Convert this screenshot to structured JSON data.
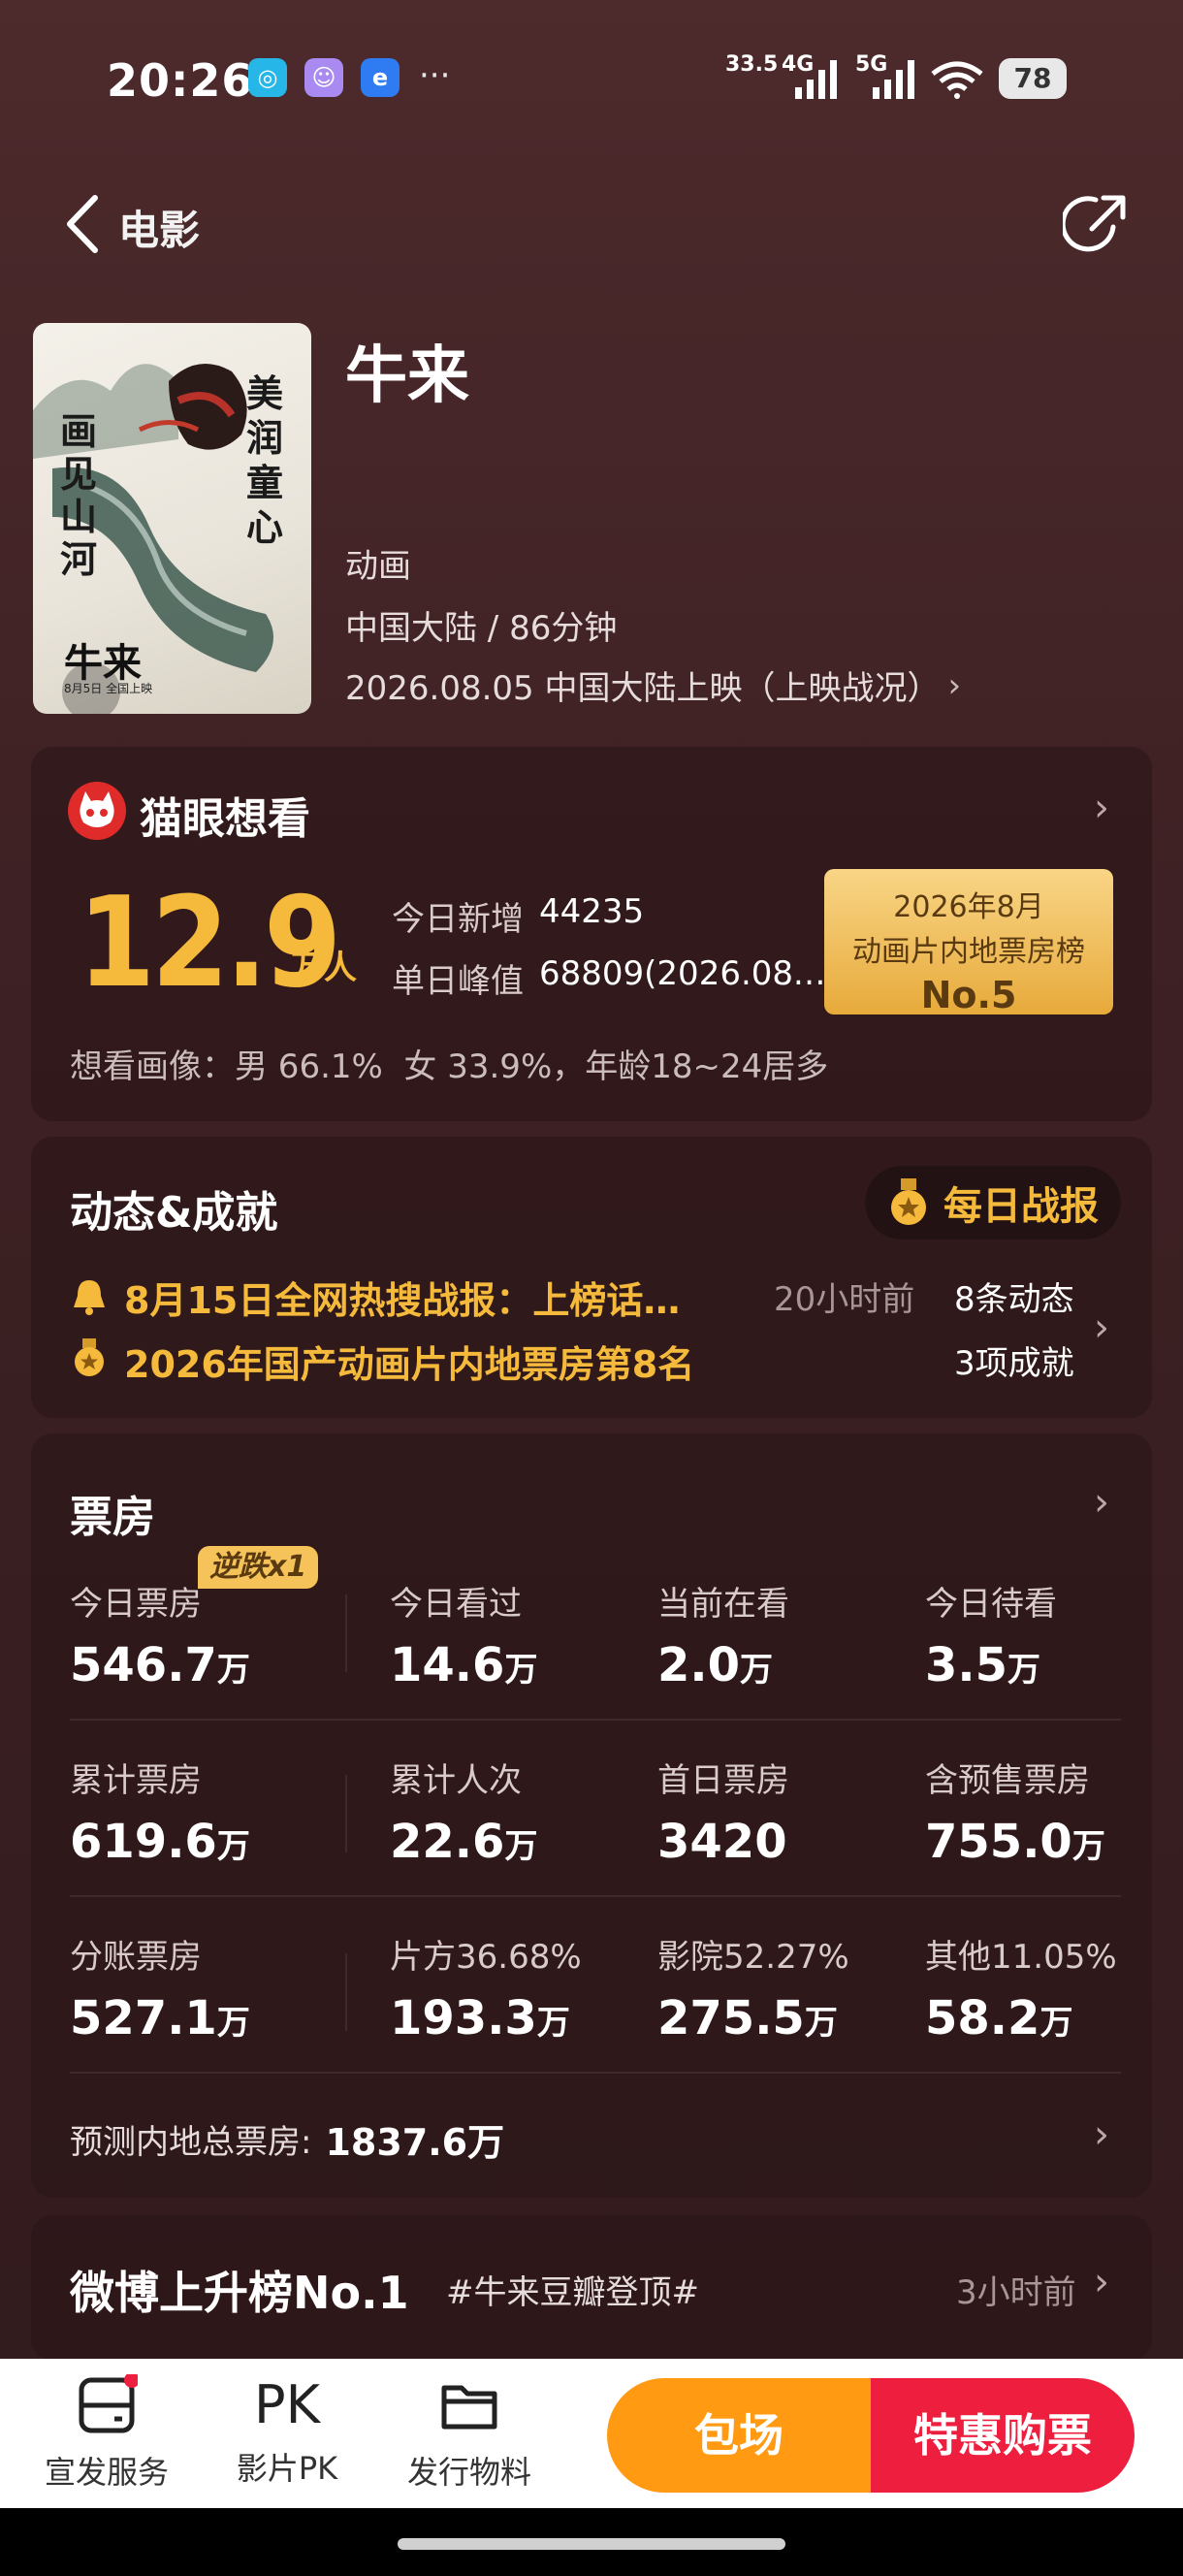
{
  "status_bar": {
    "time": "20:26",
    "net_speed": "33.5",
    "net1": "4G",
    "net2": "5G",
    "battery": "78",
    "more": "···"
  },
  "nav": {
    "back_label": "电影"
  },
  "movie": {
    "title": "牛来",
    "poster_text": {
      "left": "画见山河",
      "right": "美润童心",
      "name": "牛来",
      "date": "8月5日 全国上映"
    },
    "genre": "动画",
    "region_duration": "中国大陆 / 86分钟",
    "release": "2026.08.05 中国大陆上映（上映战况）"
  },
  "wish": {
    "title": "猫眼想看",
    "number": "12.9",
    "unit": "万人",
    "today_label": "今日新增",
    "today_value": "44235",
    "peak_label": "单日峰值",
    "peak_value": "68809(2026.08.…",
    "rank_line1": "2026年8月",
    "rank_line2": "动画片内地票房榜",
    "rank_no": "No.5",
    "portrait": "想看画像：男 66.1%  女 33.9%，年龄18~24居多"
  },
  "news": {
    "title": "动态&成就",
    "daily_button": "每日战报",
    "item1": "8月15日全网热搜战报：上榜话…",
    "item1_time": "20小时前",
    "item2": "2026年国产动画片内地票房第8名",
    "count1": "8条动态",
    "count2": "3项成就"
  },
  "box": {
    "title": "票房",
    "badge": "逆跌x1",
    "rows": [
      [
        {
          "label": "今日票房",
          "value": "546.7",
          "unit": "万"
        },
        {
          "label": "今日看过",
          "value": "14.6",
          "unit": "万"
        },
        {
          "label": "当前在看",
          "value": "2.0",
          "unit": "万"
        },
        {
          "label": "今日待看",
          "value": "3.5",
          "unit": "万"
        }
      ],
      [
        {
          "label": "累计票房",
          "value": "619.6",
          "unit": "万"
        },
        {
          "label": "累计人次",
          "value": "22.6",
          "unit": "万"
        },
        {
          "label": "首日票房",
          "value": "3420",
          "unit": ""
        },
        {
          "label": "含预售票房",
          "value": "755.0",
          "unit": "万"
        }
      ],
      [
        {
          "label": "分账票房",
          "value": "527.1",
          "unit": "万"
        },
        {
          "label": "片方36.68%",
          "value": "193.3",
          "unit": "万"
        },
        {
          "label": "影院52.27%",
          "value": "275.5",
          "unit": "万"
        },
        {
          "label": "其他11.05%",
          "value": "58.2",
          "unit": "万"
        }
      ]
    ],
    "forecast_label": "预测内地总票房:",
    "forecast_value": "1837.6万"
  },
  "weibo": {
    "title": "微博上升榜No.1",
    "tag": "#牛来豆瓣登顶#",
    "time": "3小时前"
  },
  "bottom": {
    "items": [
      {
        "label": "宣发服务"
      },
      {
        "label": "影片PK",
        "icon_text": "PK"
      },
      {
        "label": "发行物料"
      }
    ],
    "btn_left": "包场",
    "btn_right": "特惠购票"
  },
  "colors": {
    "accent": "#f5ba3b",
    "buy": "#ee1e3e",
    "group": "#ff9a12"
  }
}
